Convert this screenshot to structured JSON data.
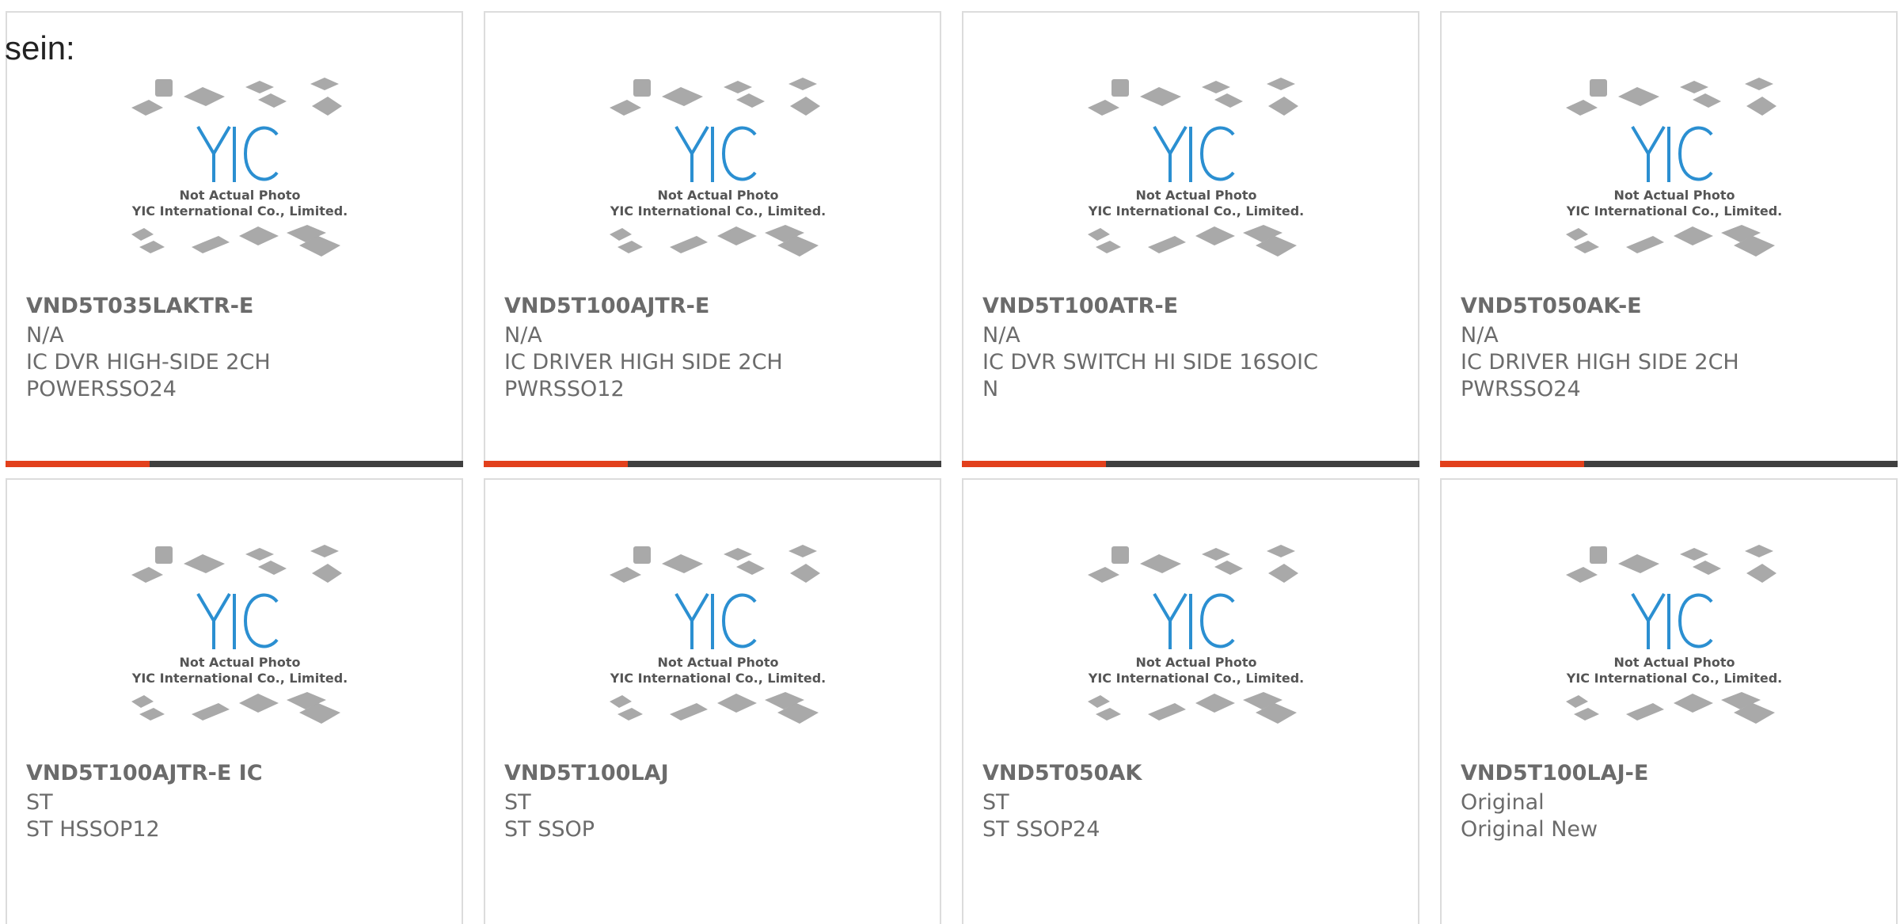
{
  "heading": "sein:",
  "logo_caption_line1": "Not Actual Photo",
  "logo_caption_line2": "YIC International Co., Limited.",
  "logo_mark": "YIC",
  "colors": {
    "accent": "#e2401c",
    "bar_dark": "#3f3f3f",
    "logo_blue": "#2b8fd1",
    "chip_gray": "#a9a9a9",
    "text": "#6b6b6b"
  },
  "products": [
    {
      "part": "VND5T035LAKTR-E",
      "lines": [
        "N/A",
        "IC DVR HIGH-SIDE 2CH",
        "POWERSSO24"
      ]
    },
    {
      "part": "VND5T100AJTR-E",
      "lines": [
        "N/A",
        "IC DRIVER HIGH SIDE 2CH",
        "PWRSSO12"
      ]
    },
    {
      "part": "VND5T100ATR-E",
      "lines": [
        "N/A",
        "IC DVR SWITCH HI SIDE 16SOIC",
        "N"
      ]
    },
    {
      "part": "VND5T050AK-E",
      "lines": [
        "N/A",
        "IC DRIVER HIGH SIDE 2CH",
        "PWRSSO24"
      ]
    },
    {
      "part": "VND5T100AJTR-E IC",
      "lines": [
        "ST",
        "ST HSSOP12"
      ]
    },
    {
      "part": "VND5T100LAJ",
      "lines": [
        "ST",
        "ST SSOP"
      ]
    },
    {
      "part": "VND5T050AK",
      "lines": [
        "ST",
        "ST SSOP24"
      ]
    },
    {
      "part": "VND5T100LAJ-E",
      "lines": [
        "Original",
        "Original New"
      ]
    }
  ]
}
